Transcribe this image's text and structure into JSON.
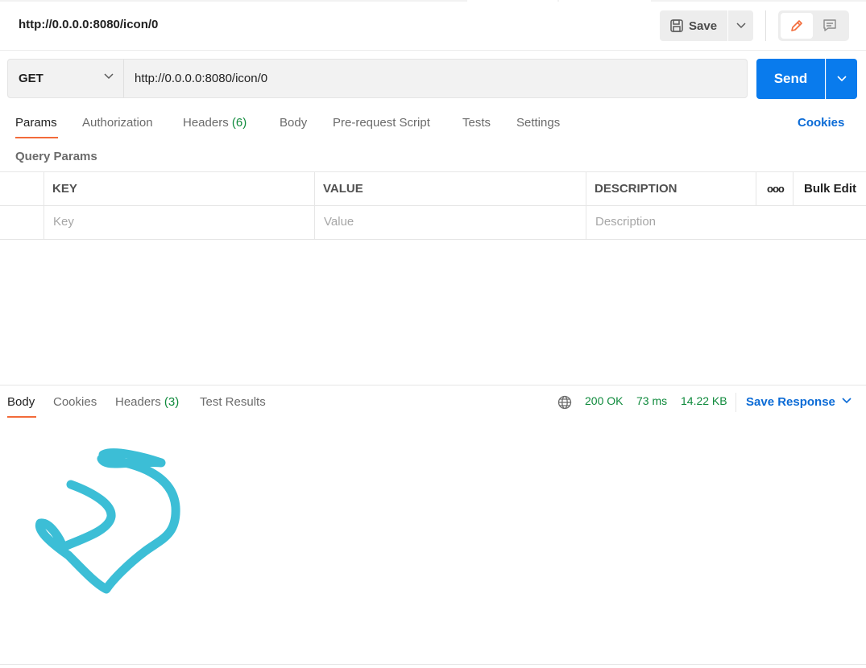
{
  "request": {
    "title": "http://0.0.0.0:8080/icon/0",
    "save_label": "Save",
    "method": "GET",
    "url": "http://0.0.0.0:8080/icon/0",
    "send_label": "Send"
  },
  "request_tabs": [
    {
      "label": "Params"
    },
    {
      "label": "Authorization"
    },
    {
      "label": "Headers",
      "count": "(6)"
    },
    {
      "label": "Body"
    },
    {
      "label": "Pre-request Script"
    },
    {
      "label": "Tests"
    },
    {
      "label": "Settings"
    }
  ],
  "cookies_link": "Cookies",
  "query_params": {
    "section_label": "Query Params",
    "columns": [
      "KEY",
      "VALUE",
      "DESCRIPTION"
    ],
    "more_label": "ooo",
    "bulk_edit_label": "Bulk Edit",
    "placeholders": {
      "key": "Key",
      "value": "Value",
      "description": "Description"
    }
  },
  "response": {
    "tabs": [
      {
        "label": "Body"
      },
      {
        "label": "Cookies"
      },
      {
        "label": "Headers",
        "count": "(3)"
      },
      {
        "label": "Test Results"
      }
    ],
    "status": "200 OK",
    "time": "73 ms",
    "size": "14.22 KB",
    "save_response_label": "Save Response",
    "body_image": {
      "icon": "squiggle-image",
      "color": "#2bb8d2"
    }
  },
  "colors": {
    "accent": "#097bed",
    "link": "#0b6bd6",
    "active_tab_underline": "#f26b3a",
    "success": "#0f8a3c"
  }
}
